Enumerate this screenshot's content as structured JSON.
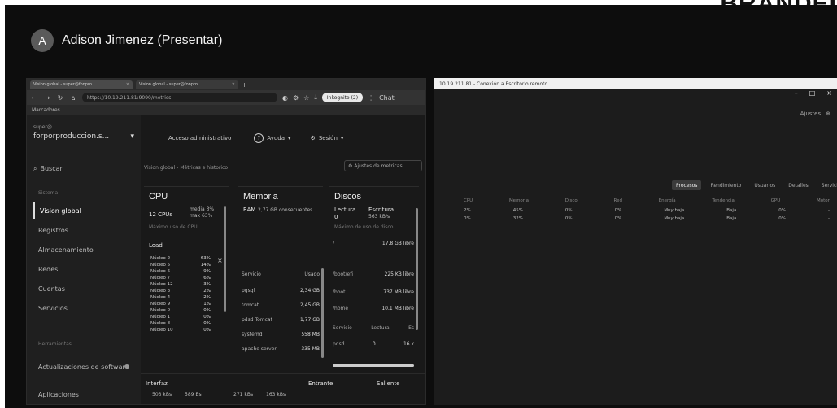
{
  "brand": "BRANDEI",
  "presenter": {
    "initial": "A",
    "name": "Adison Jimenez (Presentar)"
  },
  "browser": {
    "tabs": [
      {
        "label": "Vision global - super@fonpro...",
        "close": "×"
      },
      {
        "label": "Vision global - super@fonpro...",
        "close": "×"
      }
    ],
    "new_tab": "+",
    "url": "https://10.19.211.81:9090/metrics",
    "incognito_label": "Inkognito (2)",
    "menu_label": "Chat",
    "bookmarks_label": "Marcadores"
  },
  "sidebar": {
    "host_label": "super@",
    "host_value": "forporproduccion.s...",
    "search_label": "Buscar",
    "items": [
      {
        "label": "Sistema",
        "section": true
      },
      {
        "label": "Vision global",
        "active": true
      },
      {
        "label": "Registros"
      },
      {
        "label": "Almacenamiento"
      },
      {
        "label": "Redes"
      },
      {
        "label": "Cuentas"
      },
      {
        "label": "Servicios"
      },
      {
        "label": "Herramientas",
        "section": true
      },
      {
        "label": "Actualizaciones de software",
        "dot": true
      },
      {
        "label": "Aplicaciones"
      }
    ]
  },
  "topnav": {
    "admin_access": "Acceso administrativo",
    "help": "Ayuda",
    "session": "Sesión"
  },
  "breadcrumb": "Vision global  ›  Métricas e historico",
  "filter_button": "Ajustes de metricas",
  "cpu": {
    "title": "CPU",
    "cores_count": "12 CPUs",
    "avg_label": "media 3%",
    "max_label": "max 63%",
    "usage_note": "Máximo uso de CPU",
    "load_label": "Load",
    "cores": [
      {
        "name": "Núcleo 2",
        "value": "63%"
      },
      {
        "name": "Núcleo 5",
        "value": "14%"
      },
      {
        "name": "Núcleo 6",
        "value": "9%"
      },
      {
        "name": "Núcleo 7",
        "value": "6%"
      },
      {
        "name": "Núcleo 12",
        "value": "3%"
      },
      {
        "name": "Núcleo 3",
        "value": "2%"
      },
      {
        "name": "Núcleo 4",
        "value": "2%"
      },
      {
        "name": "Núcleo 9",
        "value": "1%"
      },
      {
        "name": "Núcleo 0",
        "value": "0%"
      },
      {
        "name": "Núcleo 1",
        "value": "0%"
      },
      {
        "name": "Núcleo 8",
        "value": "0%"
      },
      {
        "name": "Núcleo 10",
        "value": "0%"
      }
    ]
  },
  "memory": {
    "title": "Memoria",
    "ram_label": "RAM",
    "ram_value": "2,77 GB consecuentes",
    "service_header": "Servicio",
    "used_header": "Usado",
    "rows": [
      {
        "name": "pgsql",
        "value": "2,34 GB"
      },
      {
        "name": "tomcat",
        "value": "2,45 GB"
      },
      {
        "name": "pdsd Tomcat",
        "value": "1,77 GB"
      },
      {
        "name": "systemd",
        "value": "558 MB"
      },
      {
        "name": "apache server",
        "value": "335 MB"
      }
    ]
  },
  "disks": {
    "title": "Discos",
    "read_label": "Lectura",
    "read_value": "0",
    "write_label": "Escritura",
    "write_value": "563 kB/s",
    "usage_note": "Máximo de uso de disco",
    "free_rows": [
      {
        "name": "/",
        "value": "17,8 GB libre"
      },
      {
        "name": "/boot/efi",
        "value": "225 KB libre"
      },
      {
        "name": "/boot",
        "value": "737 MB libre"
      },
      {
        "name": "/home",
        "value": "10,1 MB libre"
      }
    ],
    "service_header": "Servicio",
    "read_header": "Lectura",
    "write_header": "Es",
    "service_row": {
      "name": "pdsd",
      "read": "0",
      "write": "16 k"
    }
  },
  "network": {
    "label": "Interfaz",
    "in_header": "Entrante",
    "out_header": "Saliente",
    "row_values": [
      "503 kBs",
      "589 Bs",
      "271 kBs",
      "163 kBs"
    ]
  },
  "extensions": [
    "⌂",
    "◎",
    "≡",
    "⧉",
    "◨"
  ],
  "right_window": {
    "title": "10.19.211.81 - Conexión a Escritorio remoto",
    "controls": [
      "–",
      "□",
      "×"
    ],
    "toolbar_label": "Ajustes",
    "tabs": [
      {
        "label": "Procesos",
        "selected": true
      },
      {
        "label": "Rendimiento"
      },
      {
        "label": "Usuarios"
      },
      {
        "label": "Detalles"
      },
      {
        "label": "Servicios"
      }
    ],
    "headers": [
      "CPU",
      "Memoria",
      "Disco",
      "Red",
      "Energía",
      "Tendencia",
      "GPU",
      "Motor"
    ],
    "rows": [
      [
        "2%",
        "45%",
        "0%",
        "0%",
        "Muy baja",
        "Baja",
        "0%",
        "-"
      ],
      [
        "0%",
        "32%",
        "0%",
        "0%",
        "Muy baja",
        "Baja",
        "0%",
        "-"
      ]
    ]
  }
}
